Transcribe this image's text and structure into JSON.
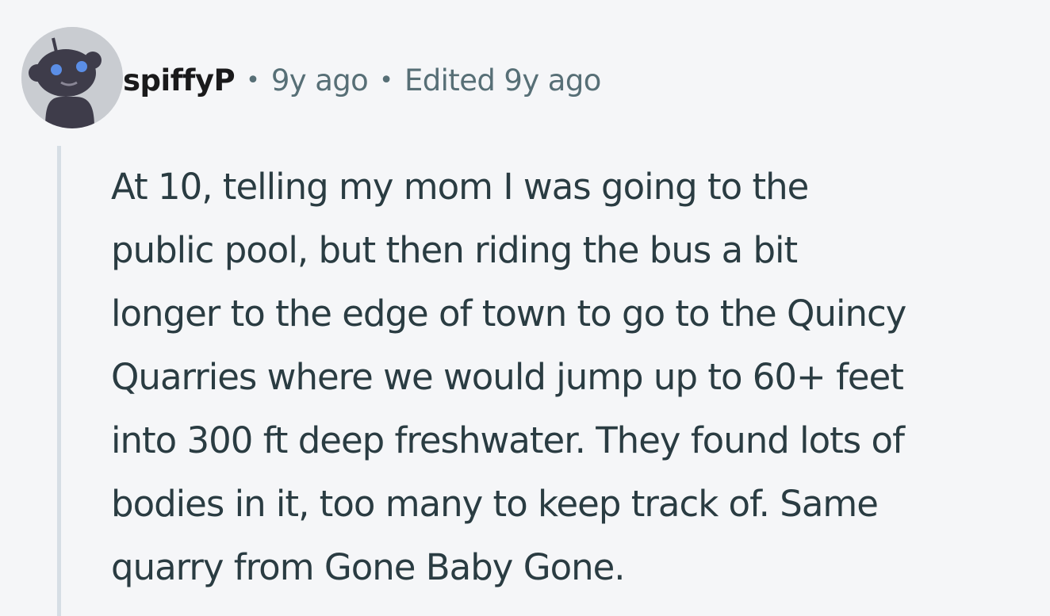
{
  "comment": {
    "author": "spiffyP",
    "separator": "•",
    "posted": "9y ago",
    "edited": "Edited 9y ago",
    "body_lines": [
      "At 10, telling my mom I was going to the",
      "public pool, but then riding the bus a bit",
      "longer to the edge of town to go to the Quincy",
      "Quarries where we would jump up to 60+ feet",
      "into 300 ft deep freshwater. They found lots of",
      "bodies in it, too many to keep track of. Same",
      "quarry from Gone Baby Gone."
    ]
  },
  "avatar": {
    "icon": "snoo-avatar-icon",
    "bg_color": "#c9ccd1",
    "body_color": "#3e3c4a",
    "eye_color": "#5b8ee6"
  },
  "colors": {
    "author": "#1a1a1b",
    "meta": "#576f76",
    "body_text": "#2a3c42",
    "thread_line": "#d6dee5",
    "background": "#f5f6f8"
  }
}
